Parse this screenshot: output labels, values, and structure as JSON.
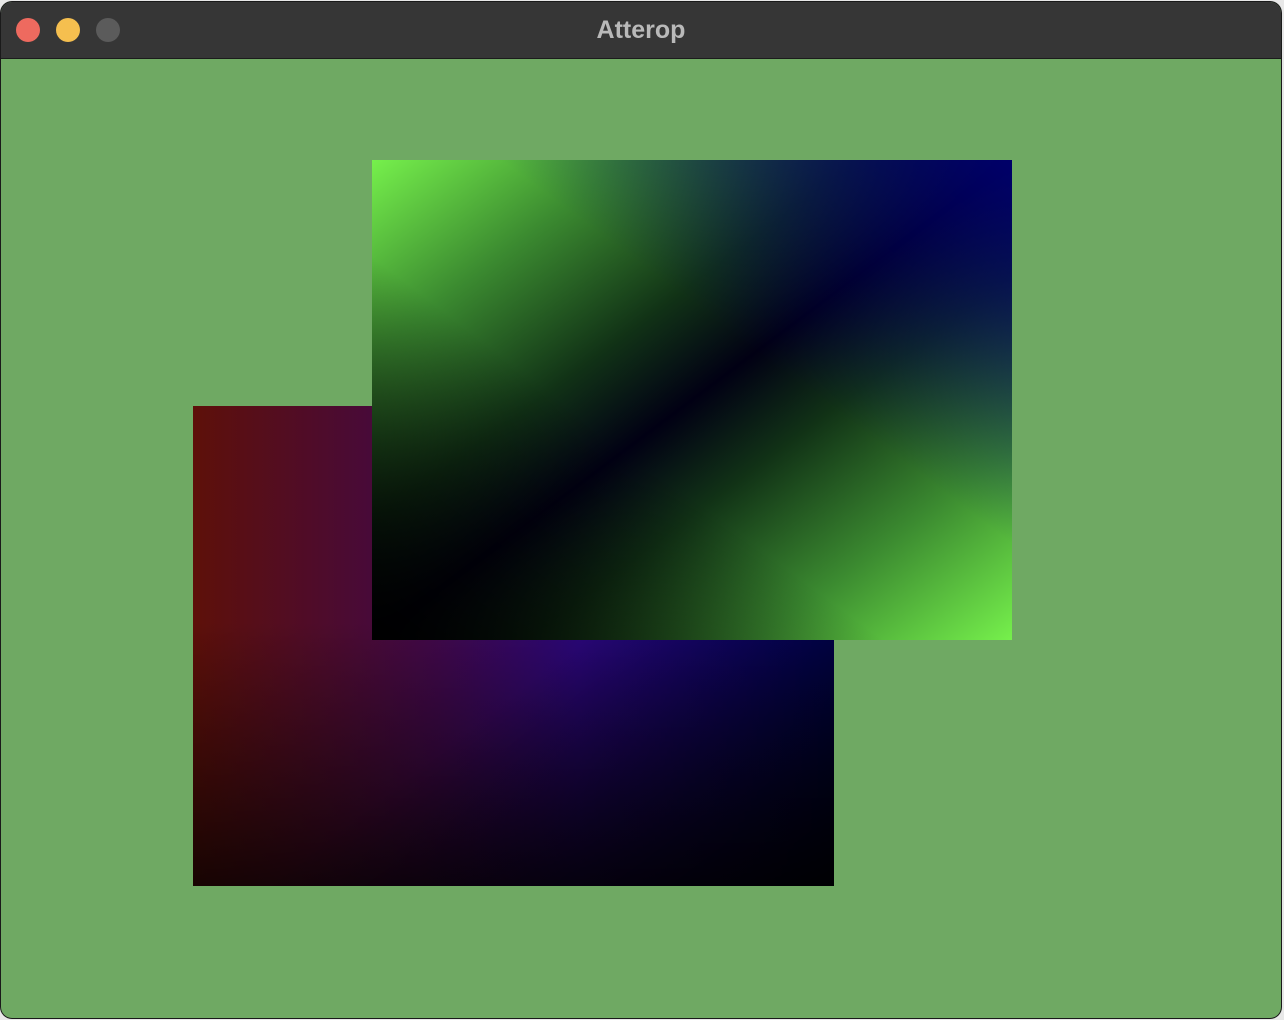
{
  "window": {
    "title": "Atterop",
    "buttons": {
      "close_color": "#ee6a5f",
      "minimize_color": "#f5bf4f",
      "zoom_color": "#5b5b5b"
    }
  },
  "canvas": {
    "background_color": "#6fa963",
    "shapes": [
      {
        "name": "back-gradient-rectangle",
        "colors": [
          "#5e1009",
          "#40084a",
          "#00036e",
          "#000000"
        ]
      },
      {
        "name": "front-gradient-rectangle",
        "colors": [
          "#76f04c",
          "#000000",
          "#000066"
        ]
      }
    ]
  }
}
